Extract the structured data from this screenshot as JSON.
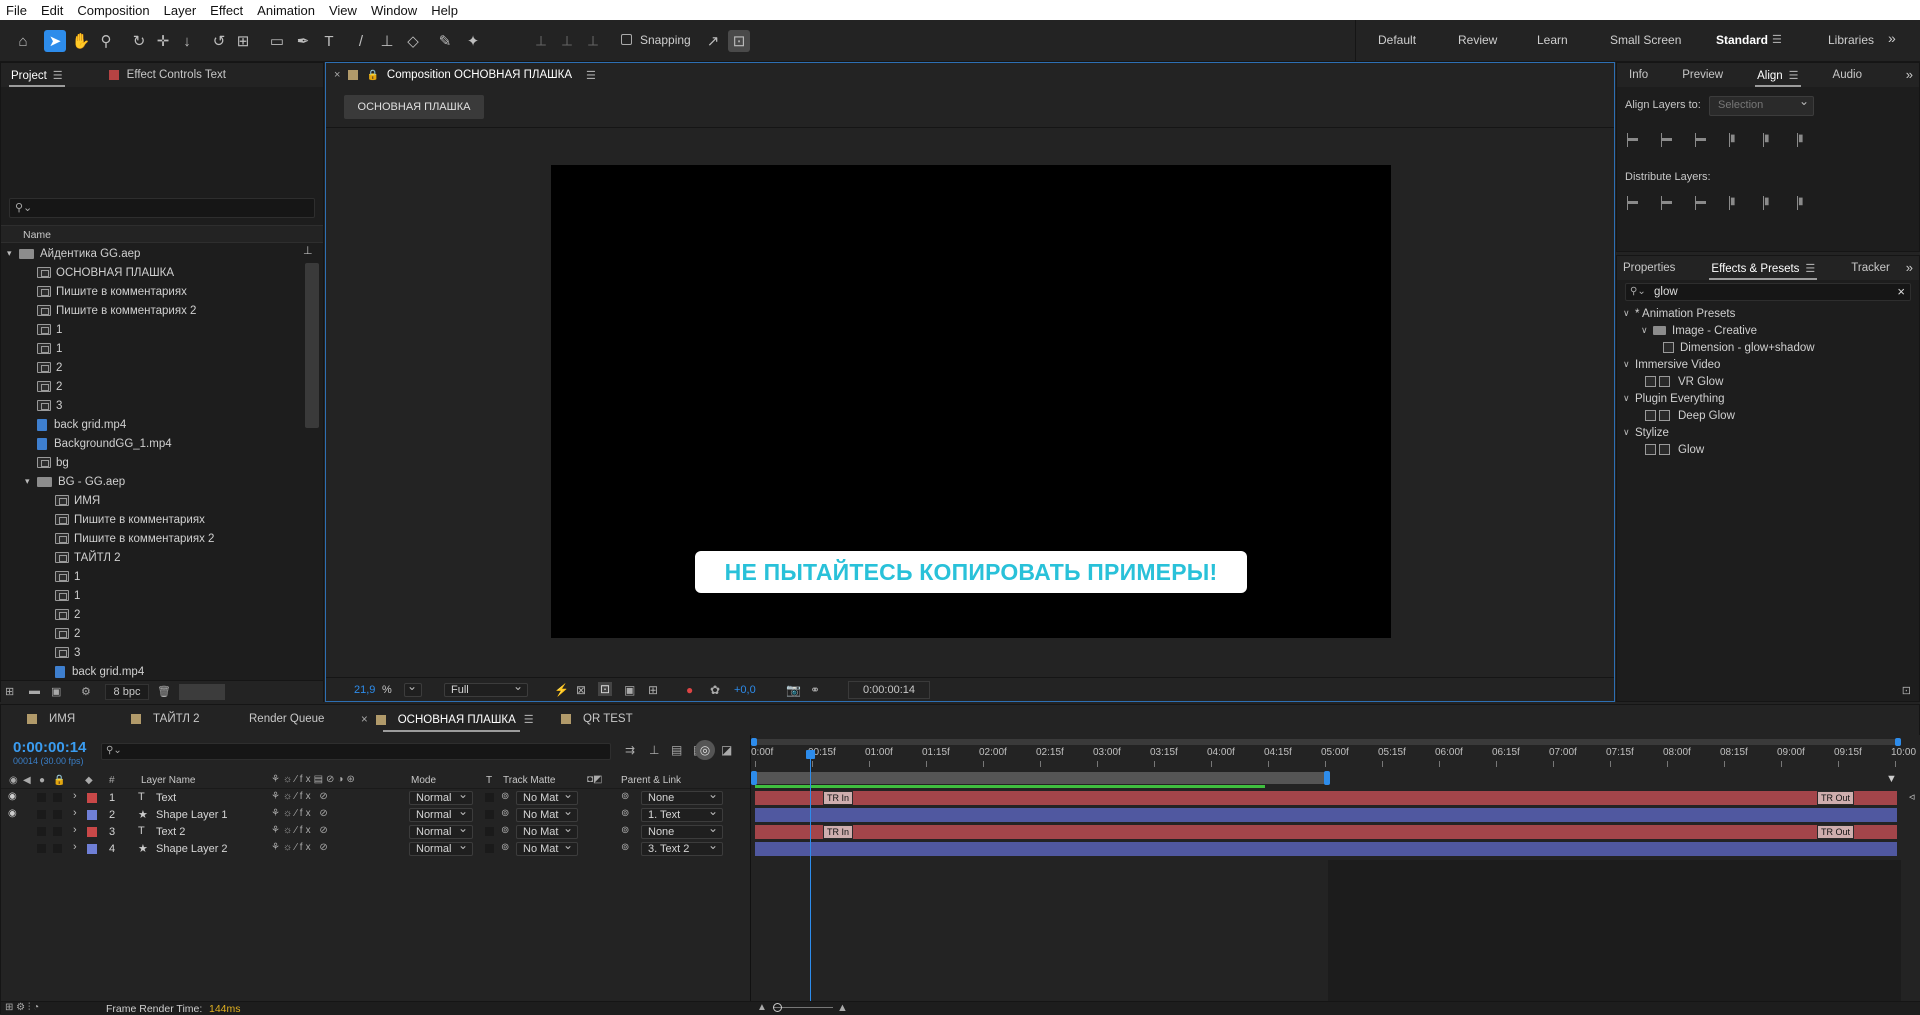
{
  "menu": [
    "File",
    "Edit",
    "Composition",
    "Layer",
    "Effect",
    "Animation",
    "View",
    "Window",
    "Help"
  ],
  "toolbar": {
    "snapping_label": "Snapping",
    "workspaces": [
      "Default",
      "Review",
      "Learn",
      "Small Screen",
      "Standard",
      "Libraries"
    ],
    "active_workspace": "Standard"
  },
  "project": {
    "tab_project": "Project",
    "tab_effect_controls": "Effect Controls Text",
    "column_name": "Name",
    "bpc": "8 bpc",
    "items": [
      {
        "label": "Айдентика GG.aep",
        "type": "folder",
        "indent": 0,
        "open": true
      },
      {
        "label": "ОСНОВНАЯ ПЛАШКА",
        "type": "comp",
        "indent": 1
      },
      {
        "label": "Пишите в комментариях",
        "type": "comp",
        "indent": 1
      },
      {
        "label": "Пишите в комментариях 2",
        "type": "comp",
        "indent": 1
      },
      {
        "label": "1",
        "type": "comp",
        "indent": 1
      },
      {
        "label": "1",
        "type": "comp",
        "indent": 1
      },
      {
        "label": "2",
        "type": "comp",
        "indent": 1
      },
      {
        "label": "2",
        "type": "comp",
        "indent": 1
      },
      {
        "label": "3",
        "type": "comp",
        "indent": 1
      },
      {
        "label": "back grid.mp4",
        "type": "video",
        "indent": 1
      },
      {
        "label": "BackgroundGG_1.mp4",
        "type": "video",
        "indent": 1
      },
      {
        "label": "bg",
        "type": "comp",
        "indent": 1
      },
      {
        "label": "BG - GG.aep",
        "type": "folder",
        "indent": 1,
        "open": true
      },
      {
        "label": "ИМЯ",
        "type": "comp",
        "indent": 2
      },
      {
        "label": "Пишите в комментариях",
        "type": "comp",
        "indent": 2
      },
      {
        "label": "Пишите в комментариях 2",
        "type": "comp",
        "indent": 2
      },
      {
        "label": "ТАЙТЛ 2",
        "type": "comp",
        "indent": 2
      },
      {
        "label": "1",
        "type": "comp",
        "indent": 2
      },
      {
        "label": "1",
        "type": "comp",
        "indent": 2
      },
      {
        "label": "2",
        "type": "comp",
        "indent": 2
      },
      {
        "label": "2",
        "type": "comp",
        "indent": 2
      },
      {
        "label": "3",
        "type": "comp",
        "indent": 2
      },
      {
        "label": "back grid.mp4",
        "type": "video",
        "indent": 2
      }
    ]
  },
  "composition": {
    "tab_label": "Composition ОСНОВНАЯ ПЛАШКА",
    "breadcrumb": "ОСНОВНАЯ ПЛАШКА",
    "overlay_text": "НЕ ПЫТАЙТЕСЬ КОПИРОВАТЬ ПРИМЕРЫ!",
    "zoom": "21,9",
    "zoom_unit": "%",
    "resolution": "Full",
    "exposure": "+0,0",
    "timecode": "0:00:00:14"
  },
  "align": {
    "tabs": [
      "Info",
      "Preview",
      "Align",
      "Audio"
    ],
    "align_layers_to_label": "Align Layers to:",
    "align_layers_to_value": "Selection",
    "distribute_label": "Distribute Layers:"
  },
  "effects": {
    "tabs": [
      "Properties",
      "Effects & Presets",
      "Tracker"
    ],
    "search_value": "glow",
    "tree": [
      {
        "label": "* Animation Presets",
        "level": 0,
        "kind": "group"
      },
      {
        "label": "Image - Creative",
        "level": 1,
        "kind": "folder"
      },
      {
        "label": "Dimension - glow+shadow",
        "level": 2,
        "kind": "preset"
      },
      {
        "label": "Immersive Video",
        "level": 0,
        "kind": "group"
      },
      {
        "label": "VR Glow",
        "level": 1,
        "kind": "effect"
      },
      {
        "label": "Plugin Everything",
        "level": 0,
        "kind": "group"
      },
      {
        "label": "Deep Glow",
        "level": 1,
        "kind": "effect"
      },
      {
        "label": "Stylize",
        "level": 0,
        "kind": "group"
      },
      {
        "label": "Glow",
        "level": 1,
        "kind": "effect"
      }
    ]
  },
  "timeline": {
    "tabs": [
      {
        "label": "ИМЯ",
        "color": "#b19a6a",
        "active": false
      },
      {
        "label": "ТАЙТЛ 2",
        "color": "#b19a6a",
        "active": false
      },
      {
        "label": "Render Queue",
        "color": "",
        "active": false
      },
      {
        "label": "ОСНОВНАЯ ПЛАШКА",
        "color": "#b19a6a",
        "active": true
      },
      {
        "label": "QR TEST",
        "color": "#b19a6a",
        "active": false
      }
    ],
    "current_time": "0:00:00:14",
    "frame_info": "00014 (30.00 fps)",
    "columns": {
      "layer_name": "Layer Name",
      "mode": "Mode",
      "t": "T",
      "track_matte": "Track Matte",
      "parent": "Parent & Link"
    },
    "layers": [
      {
        "num": "1",
        "name": "Text",
        "kind": "T",
        "color": "#c94848",
        "mode": "Normal",
        "matte": "No Mat",
        "parent": "None",
        "visible": true,
        "bar_color": "#a3454a",
        "markers": true
      },
      {
        "num": "2",
        "name": "Shape Layer 1",
        "kind": "★",
        "color": "#6f7fd6",
        "mode": "Normal",
        "matte": "No Mat",
        "parent": "1. Text",
        "visible": true,
        "bar_color": "#5058a0",
        "markers": false
      },
      {
        "num": "3",
        "name": "Text 2",
        "kind": "T",
        "color": "#c94848",
        "mode": "Normal",
        "matte": "No Mat",
        "parent": "None",
        "visible": false,
        "bar_color": "#a3454a",
        "markers": true
      },
      {
        "num": "4",
        "name": "Shape Layer 2",
        "kind": "★",
        "color": "#6f7fd6",
        "mode": "Normal",
        "matte": "No Mat",
        "parent": "3. Text 2",
        "visible": false,
        "bar_color": "#5058a0",
        "markers": false
      }
    ],
    "marker_in": "TR In",
    "marker_out": "TR Out",
    "ruler": [
      "0:00f",
      "00:15f",
      "01:00f",
      "01:15f",
      "02:00f",
      "02:15f",
      "03:00f",
      "03:15f",
      "04:00f",
      "04:15f",
      "05:00f",
      "05:15f",
      "06:00f",
      "06:15f",
      "07:00f",
      "07:15f",
      "08:00f",
      "08:15f",
      "09:00f",
      "09:15f",
      "10:00"
    ],
    "frame_render_label": "Frame Render Time:",
    "frame_render_value": "144ms"
  },
  "colors": {
    "accent": "#2d8ceb",
    "text_cyan": "#29c1d9",
    "render_time": "#e0b020"
  }
}
